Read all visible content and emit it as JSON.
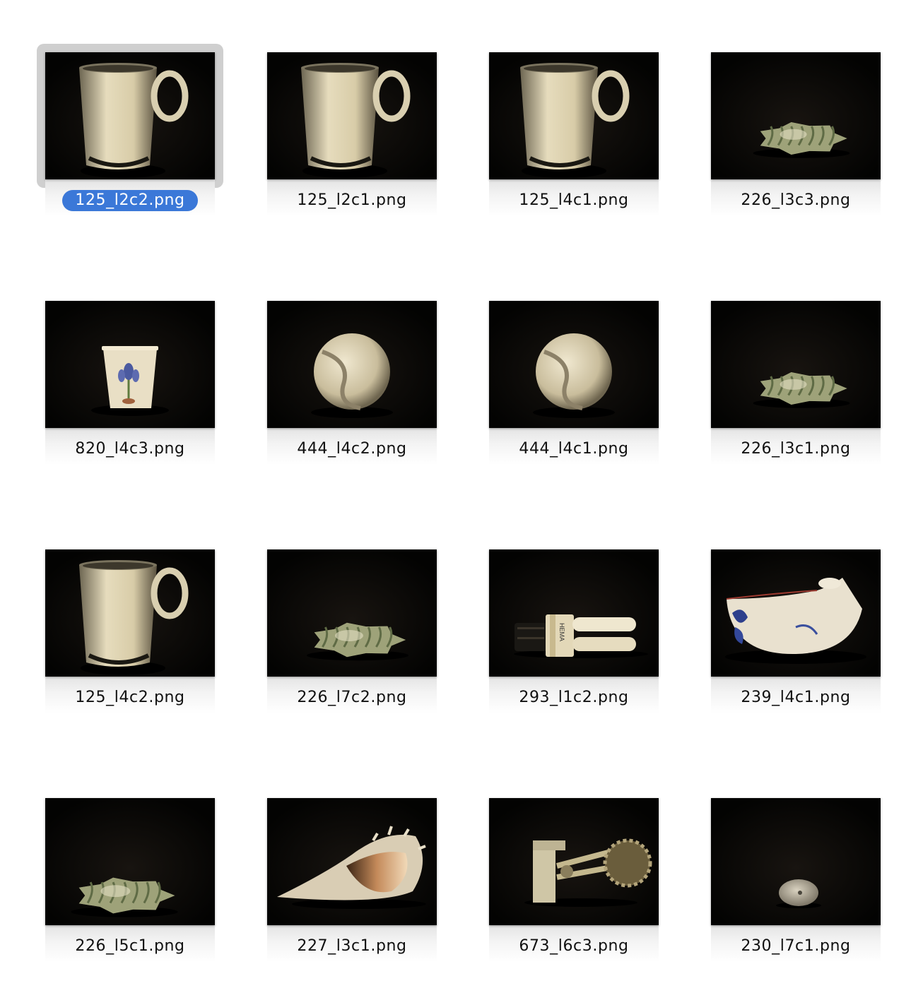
{
  "files": [
    {
      "name": "125_l2c2.png",
      "icon": "mug-icon",
      "selected": true
    },
    {
      "name": "125_l2c1.png",
      "icon": "mug-icon",
      "selected": false
    },
    {
      "name": "125_l4c1.png",
      "icon": "mug-icon",
      "selected": false
    },
    {
      "name": "226_l3c3.png",
      "icon": "crumpled-object-icon",
      "selected": false
    },
    {
      "name": "820_l4c3.png",
      "icon": "paper-cup-icon",
      "selected": false
    },
    {
      "name": "444_l4c2.png",
      "icon": "tennis-ball-icon",
      "selected": false
    },
    {
      "name": "444_l4c1.png",
      "icon": "tennis-ball-icon",
      "selected": false
    },
    {
      "name": "226_l3c1.png",
      "icon": "crumpled-object-icon",
      "selected": false
    },
    {
      "name": "125_l4c2.png",
      "icon": "mug-icon",
      "selected": false
    },
    {
      "name": "226_l7c2.png",
      "icon": "crumpled-object-icon",
      "selected": false
    },
    {
      "name": "293_l1c2.png",
      "icon": "light-bulb-icon",
      "selected": false
    },
    {
      "name": "239_l4c1.png",
      "icon": "gravy-boat-icon",
      "selected": false
    },
    {
      "name": "226_l5c1.png",
      "icon": "crumpled-object-icon",
      "selected": false
    },
    {
      "name": "227_l3c1.png",
      "icon": "seashell-icon",
      "selected": false
    },
    {
      "name": "673_l6c3.png",
      "icon": "bottle-opener-icon",
      "selected": false
    },
    {
      "name": "230_l7c1.png",
      "icon": "stone-icon",
      "selected": false
    }
  ],
  "colors": {
    "selection": "#3b78d8",
    "selection_frame": "#cfcfcf",
    "thumb_background": "#050403"
  }
}
